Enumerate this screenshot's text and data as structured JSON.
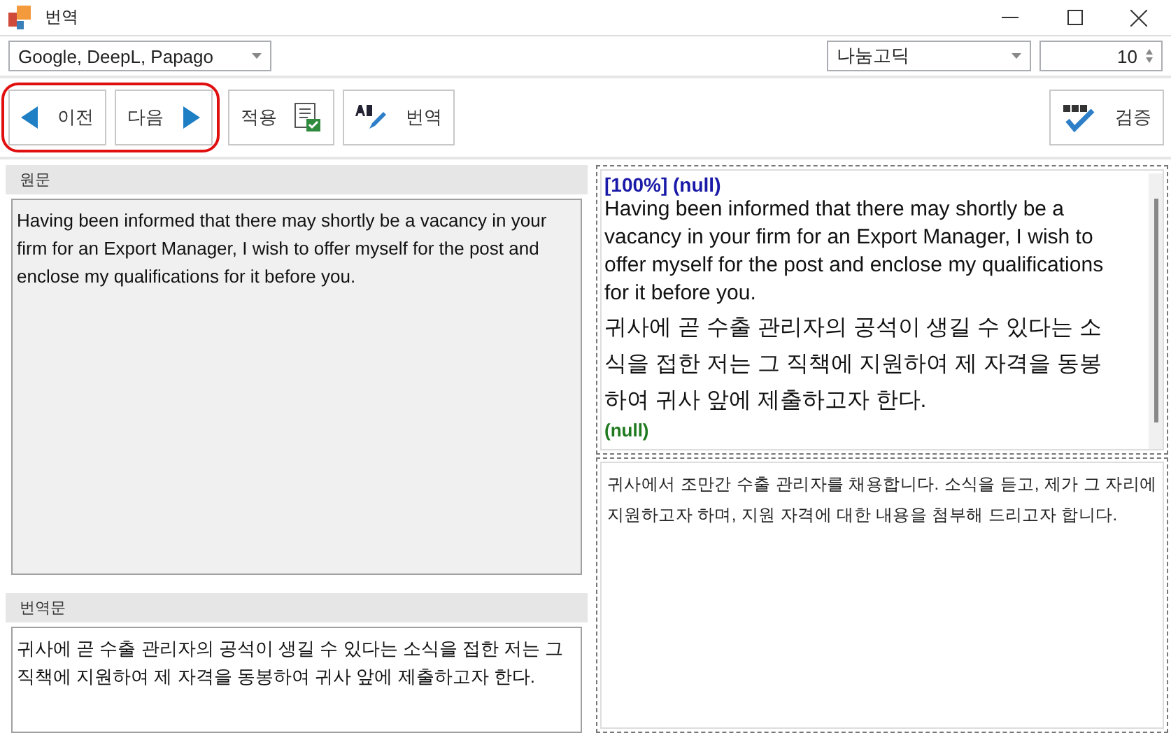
{
  "window": {
    "title": "번역"
  },
  "engine_select": {
    "value": "Google, DeepL, Papago"
  },
  "font_select": {
    "value": "나눔고딕"
  },
  "font_size": {
    "value": "10"
  },
  "toolbar": {
    "nav_highlighted": true,
    "nav_buttons": [
      {
        "kind": "prev",
        "label": "이전"
      },
      {
        "kind": "next",
        "label": "다음"
      }
    ],
    "buttons": [
      {
        "kind": "apply",
        "label": "적용"
      },
      {
        "kind": "translate",
        "label": "번역"
      }
    ],
    "right_buttons": [
      {
        "kind": "verify",
        "label": "검증"
      }
    ]
  },
  "source": {
    "header": "원문",
    "text": "Having been informed that there may shortly be a vacancy in your firm for an Export Manager, I wish to offer myself for the post and enclose my qualifications for it before you."
  },
  "translation": {
    "header": "번역문",
    "text": "귀사에 곧 수출 관리자의 공석이 생길 수 있다는 소식을 접한 저는 그 직책에 지원하여 제 자격을 동봉하여 귀사 앞에 제출하고자 한다."
  },
  "memory_match": {
    "score_line": "[100%] (null)",
    "source": "Having been informed that there may shortly be a vacancy in your firm for an Export Manager, I wish to offer myself for the post and enclose my qualifications for it before you.",
    "target": "귀사에 곧 수출 관리자의 공석이 생길 수 있다는 소식을 접한 저는 그 직책에 지원하여 제 자격을 동봉하여 귀사 앞에 제출하고자 한다.",
    "author": "(null)"
  },
  "alt_translation": {
    "text": "귀사에서 조만간 수출 관리자를 채용합니다. 소식을 듣고, 제가 그 자리에 지원하고자 하며, 지원 자격에 대한 내용을 첨부해 드리고자 합니다."
  }
}
